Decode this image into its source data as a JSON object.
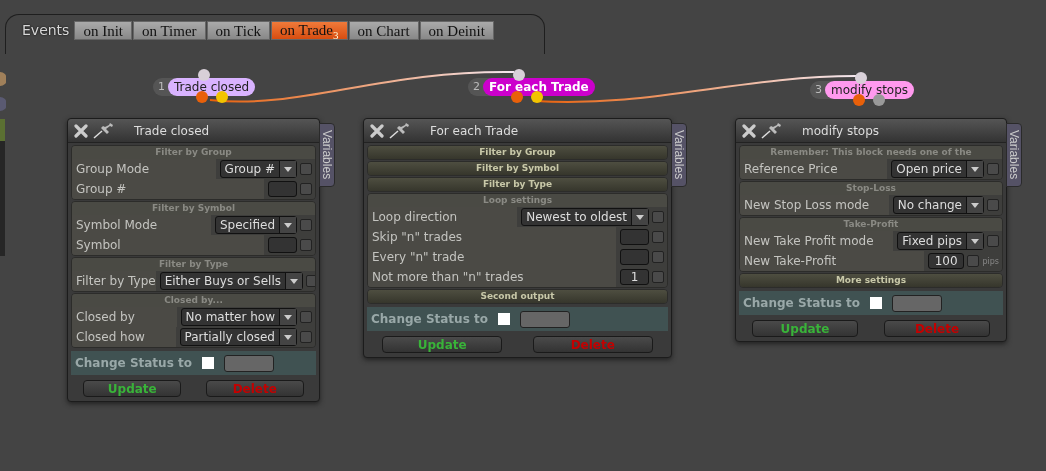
{
  "tab_bar": {
    "label": "Events",
    "tabs": [
      {
        "label": "on Init",
        "selected": false
      },
      {
        "label": "on Timer",
        "selected": false
      },
      {
        "label": "on Tick",
        "selected": false
      },
      {
        "label": "on Trade$_{3}$",
        "selected": true
      },
      {
        "label": "on Chart",
        "selected": false
      },
      {
        "label": "on Deinit",
        "selected": false
      }
    ]
  },
  "nodes": [
    {
      "number": "1",
      "label": "Trade closed",
      "color": "#d9b3ff",
      "selected": false
    },
    {
      "number": "2",
      "label": "For each Trade",
      "color": "#cc00cc",
      "selected": true
    },
    {
      "number": "3",
      "label": "modify stops",
      "color": "#ff99ee",
      "selected": false
    }
  ],
  "panels": [
    {
      "title": "Trade closed",
      "side_tab": "Variables",
      "sections": [
        {
          "title": "Filter by Group",
          "expanded": true,
          "rows": [
            {
              "label": "Group Mode",
              "kind": "select",
              "value": "Group #",
              "checked": false
            },
            {
              "label": "Group #",
              "kind": "input",
              "checked": false
            }
          ]
        },
        {
          "title": "Filter by Symbol",
          "expanded": true,
          "rows": [
            {
              "label": "Symbol Mode",
              "kind": "select",
              "value": "Specified",
              "checked": false
            },
            {
              "label": "Symbol",
              "kind": "input",
              "checked": false
            }
          ]
        },
        {
          "title": "Filter by Type",
          "expanded": true,
          "rows": [
            {
              "label": "Filter by Type",
              "kind": "select",
              "value": "Either Buys or Sells",
              "checked": false
            }
          ]
        },
        {
          "title": "Closed by...",
          "expanded": true,
          "rows": [
            {
              "label": "Closed by",
              "kind": "select",
              "value": "No matter how",
              "checked": false
            },
            {
              "label": "Closed how",
              "kind": "select",
              "value": "Partially closed",
              "checked": false
            }
          ]
        }
      ],
      "status_label": "Change Status to",
      "status_checked": false,
      "buttons": [
        {
          "label": "Update",
          "kind": "update"
        },
        {
          "label": "Delete",
          "kind": "delete"
        }
      ]
    },
    {
      "title": "For each Trade",
      "side_tab": "Variables",
      "sections": [
        {
          "title": "Filter by Group",
          "expanded": false
        },
        {
          "title": "Filter by Symbol",
          "expanded": false
        },
        {
          "title": "Filter by Type",
          "expanded": false
        },
        {
          "title": "Loop settings",
          "expanded": true,
          "rows": [
            {
              "label": "Loop direction",
              "kind": "select",
              "value": "Newest to oldest",
              "checked": false
            },
            {
              "label": "Skip \"n\" trades",
              "kind": "input",
              "checked": false
            },
            {
              "label": "Every \"n\" trade",
              "kind": "input",
              "checked": false
            },
            {
              "label": "Not more than \"n\" trades",
              "kind": "input",
              "value": "1",
              "checked": false
            }
          ]
        },
        {
          "title": "Second output",
          "expanded": false
        }
      ],
      "status_label": "Change Status to",
      "status_checked": false,
      "buttons": [
        {
          "label": "Update",
          "kind": "update"
        },
        {
          "label": "Delete",
          "kind": "delete"
        }
      ]
    },
    {
      "title": "modify stops",
      "side_tab": "Variables",
      "sections": [
        {
          "title": "Remember: This block needs one of the",
          "expanded": true,
          "rows": [
            {
              "label": "Reference Price",
              "kind": "select",
              "value": "Open price",
              "checked": false
            }
          ]
        },
        {
          "title": "Stop-Loss",
          "expanded": true,
          "rows": [
            {
              "label": "New Stop Loss mode",
              "kind": "select",
              "value": "No change",
              "checked": false
            }
          ]
        },
        {
          "title": "Take-Profit",
          "expanded": true,
          "rows": [
            {
              "label": "New Take Profit mode",
              "kind": "select",
              "value": "Fixed pips",
              "checked": false
            },
            {
              "label": "New Take-Profit",
              "kind": "input",
              "value": "100",
              "unit": "pips",
              "checked": false
            }
          ]
        },
        {
          "title": "More settings",
          "expanded": false
        }
      ],
      "status_label": "Change Status to",
      "status_checked": false,
      "buttons": [
        {
          "label": "Update",
          "kind": "update"
        },
        {
          "label": "Delete",
          "kind": "delete"
        }
      ]
    }
  ]
}
